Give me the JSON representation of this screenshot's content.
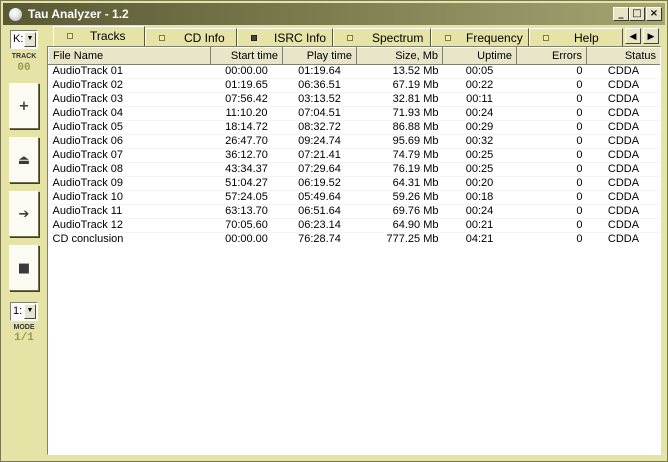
{
  "window": {
    "title": "Tau Analyzer - 1.2",
    "buttons": {
      "minimize": "_",
      "maximize": "□",
      "close": "×"
    }
  },
  "toolbar": {
    "drive": "K:",
    "track_label": "TRACK",
    "track_value": "00",
    "buttons": {
      "add": "+",
      "eject": "⏏",
      "next": "➔",
      "stop": "■"
    },
    "mode_select": "1:",
    "mode_label": "MODE",
    "mode_value": "1/1"
  },
  "tabs": [
    {
      "label": "Tracks",
      "active": true,
      "led": "light"
    },
    {
      "label": "CD Info",
      "active": false,
      "led": "light"
    },
    {
      "label": "ISRC Info",
      "active": false,
      "led": "dark"
    },
    {
      "label": "Spectrum",
      "active": false,
      "led": "light"
    },
    {
      "label": "Frequency",
      "active": false,
      "led": "light"
    },
    {
      "label": "Help",
      "active": false,
      "led": "light"
    }
  ],
  "tab_scroll": {
    "left": "◀",
    "right": "▶"
  },
  "table": {
    "columns": [
      "File Name",
      "Start time",
      "Play time",
      "Size, Mb",
      "Uptime",
      "Errors",
      "Status"
    ],
    "rows": [
      [
        "AudioTrack 01",
        "00:00.00",
        "01:19.64",
        "13.52 Mb",
        "00:05",
        "0",
        "CDDA"
      ],
      [
        "AudioTrack 02",
        "01:19.65",
        "06:36.51",
        "67.19 Mb",
        "00:22",
        "0",
        "CDDA"
      ],
      [
        "AudioTrack 03",
        "07:56.42",
        "03:13.52",
        "32.81 Mb",
        "00:11",
        "0",
        "CDDA"
      ],
      [
        "AudioTrack 04",
        "11:10.20",
        "07:04.51",
        "71.93 Mb",
        "00:24",
        "0",
        "CDDA"
      ],
      [
        "AudioTrack 05",
        "18:14.72",
        "08:32.72",
        "86.88 Mb",
        "00:29",
        "0",
        "CDDA"
      ],
      [
        "AudioTrack 06",
        "26:47.70",
        "09:24.74",
        "95.69 Mb",
        "00:32",
        "0",
        "CDDA"
      ],
      [
        "AudioTrack 07",
        "36:12.70",
        "07:21.41",
        "74.79 Mb",
        "00:25",
        "0",
        "CDDA"
      ],
      [
        "AudioTrack 08",
        "43:34.37",
        "07:29.64",
        "76.19 Mb",
        "00:25",
        "0",
        "CDDA"
      ],
      [
        "AudioTrack 09",
        "51:04.27",
        "06:19.52",
        "64.31 Mb",
        "00:20",
        "0",
        "CDDA"
      ],
      [
        "AudioTrack 10",
        "57:24.05",
        "05:49.64",
        "59.26 Mb",
        "00:18",
        "0",
        "CDDA"
      ],
      [
        "AudioTrack 11",
        "63:13.70",
        "06:51.64",
        "69.76 Mb",
        "00:24",
        "0",
        "CDDA"
      ],
      [
        "AudioTrack 12",
        "70:05.60",
        "06:23.14",
        "64.90 Mb",
        "00:21",
        "0",
        "CDDA"
      ]
    ],
    "summary": [
      "CD conclusion",
      "00:00.00",
      "76:28.74",
      "777.25 Mb",
      "04:21",
      "0",
      "CDDA"
    ]
  }
}
